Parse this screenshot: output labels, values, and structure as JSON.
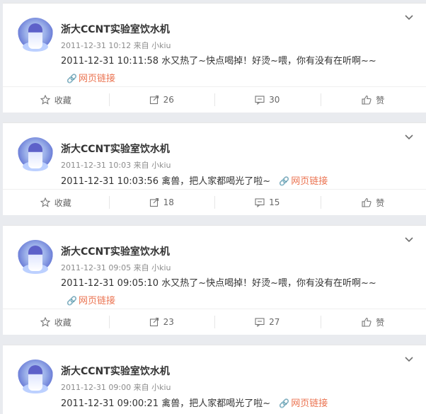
{
  "labels": {
    "source_prefix": "来自",
    "link_text": "网页链接",
    "favorite": "收藏",
    "like": "赞"
  },
  "posts": [
    {
      "author": "浙大CCNT实验室饮水机",
      "time": "2011-12-31 10:12",
      "source": "小kiu",
      "text": "2011-12-31 10:11:58 水又热了~快点喝掉！好烫~喂，你有没有在听啊~~",
      "repost_count": "26",
      "comment_count": "30"
    },
    {
      "author": "浙大CCNT实验室饮水机",
      "time": "2011-12-31 10:03",
      "source": "小kiu",
      "text": "2011-12-31 10:03:56 禽兽，把人家都喝光了啦~",
      "repost_count": "18",
      "comment_count": "15"
    },
    {
      "author": "浙大CCNT实验室饮水机",
      "time": "2011-12-31 09:05",
      "source": "小kiu",
      "text": "2011-12-31 09:05:10 水又热了~快点喝掉！好烫~喂，你有没有在听啊~~",
      "repost_count": "23",
      "comment_count": "27"
    },
    {
      "author": "浙大CCNT实验室饮水机",
      "time": "2011-12-31 09:00",
      "source": "小kiu",
      "text": "2011-12-31 09:00:21 禽兽，把人家都喝光了啦~"
    }
  ]
}
